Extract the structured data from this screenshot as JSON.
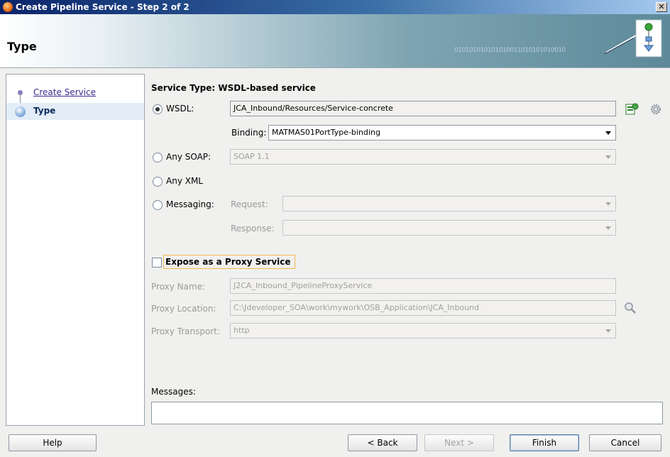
{
  "window": {
    "title": "Create Pipeline Service - Step 2 of 2"
  },
  "header": {
    "title": "Type",
    "binary_text": "010101010101010011010101010010"
  },
  "nav": {
    "steps": [
      {
        "label": "Create Service",
        "state": "done"
      },
      {
        "label": "Type",
        "state": "active"
      }
    ]
  },
  "main": {
    "heading": "Service Type: WSDL-based service",
    "wsdl": {
      "label": "WSDL:",
      "selected": true,
      "value": "JCA_Inbound/Resources/Service-concrete"
    },
    "binding": {
      "label": "Binding:",
      "value": "MATMAS01PortType-binding"
    },
    "any_soap": {
      "label": "Any SOAP:",
      "selected": false,
      "value": "SOAP 1.1"
    },
    "any_xml": {
      "label": "Any XML",
      "selected": false
    },
    "messaging": {
      "label": "Messaging:",
      "selected": false,
      "request_label": "Request:",
      "response_label": "Response:",
      "request_value": "",
      "response_value": ""
    },
    "expose": {
      "label": "Expose as a Proxy Service",
      "checked": false
    },
    "proxy_name": {
      "label": "Proxy Name:",
      "value": "J2CA_Inbound_PipelineProxyService"
    },
    "proxy_location": {
      "label": "Proxy Location:",
      "value": "C:\\Jdeveloper_SOA\\work\\mywork\\OSB_Application\\JCA_Inbound"
    },
    "proxy_transport": {
      "label": "Proxy Transport:",
      "value": "http"
    },
    "messages_label": "Messages:",
    "messages_value": ""
  },
  "footer": {
    "help": "Help",
    "back": "< Back",
    "next": "Next >",
    "finish": "Finish",
    "cancel": "Cancel"
  },
  "icons": {
    "wsdl_browse": "wsdl-browse-icon",
    "wsdl_settings": "gear-icon",
    "location_search": "magnifier-icon"
  },
  "colors": {
    "title_start": "#0a246a",
    "title_end": "#a6caf0",
    "header_accent": "#5d8999",
    "expose_highlight": "#f1b84c",
    "nav_link": "#3b2b8f"
  }
}
